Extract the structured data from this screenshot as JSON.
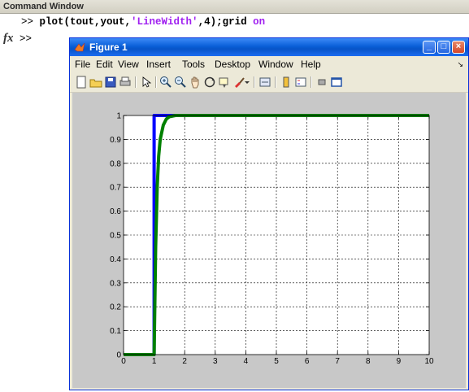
{
  "command_window": {
    "title": "Command Window",
    "line1_prompt": ">> ",
    "line1_code_a": "plot(tout,yout,",
    "line1_string": "'LineWidth'",
    "line1_code_b": ",4);grid ",
    "line1_on": "on",
    "fx_label": "fx",
    "prompt2": ">>"
  },
  "figure": {
    "title": "Figure 1",
    "menu": [
      "File",
      "Edit",
      "View",
      "Insert",
      "Tools",
      "Desktop",
      "Window",
      "Help"
    ],
    "title_color": "#0a5fd8"
  },
  "chart_data": {
    "type": "line",
    "title": "",
    "xlabel": "",
    "ylabel": "",
    "xlim": [
      0,
      10
    ],
    "ylim": [
      0,
      1
    ],
    "xticks": [
      0,
      1,
      2,
      3,
      4,
      5,
      6,
      7,
      8,
      9,
      10
    ],
    "yticks": [
      0,
      0.1,
      0.2,
      0.3,
      0.4,
      0.5,
      0.6,
      0.7,
      0.8,
      0.9,
      1
    ],
    "grid": true,
    "series": [
      {
        "color": "#0000ff",
        "x": [
          0,
          1,
          1,
          1.5,
          10
        ],
        "y": [
          0,
          0,
          1,
          1,
          1
        ]
      },
      {
        "color": "#008000",
        "x": [
          0,
          1,
          1.05,
          1.1,
          1.15,
          1.2,
          1.3,
          1.4,
          1.5,
          1.7,
          2,
          10
        ],
        "y": [
          0,
          0,
          0.45,
          0.7,
          0.83,
          0.9,
          0.96,
          0.985,
          0.995,
          1,
          1,
          1
        ]
      }
    ]
  }
}
